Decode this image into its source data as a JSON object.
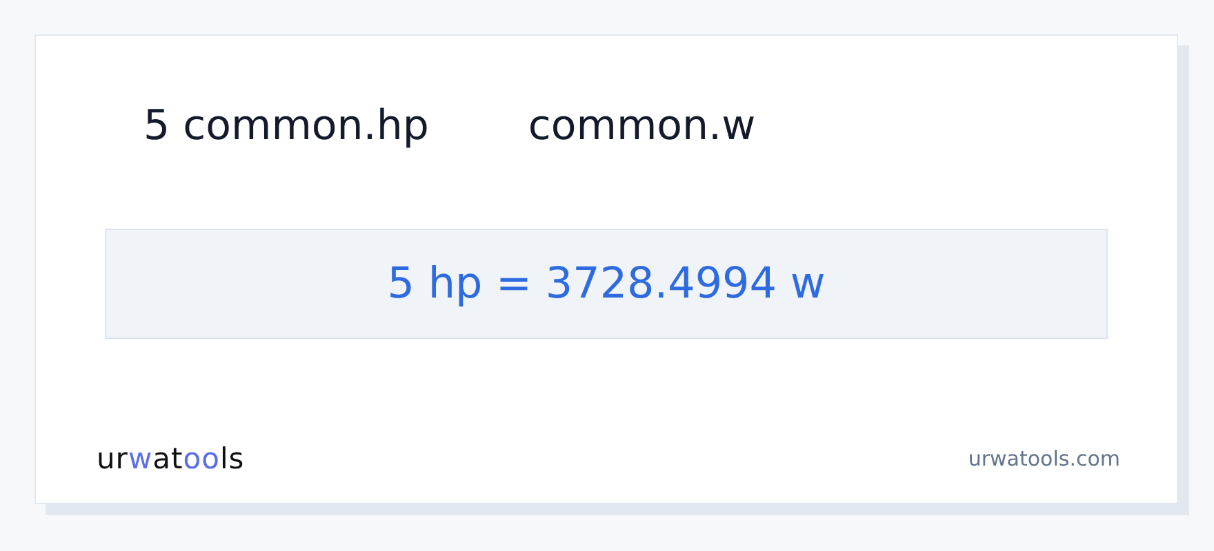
{
  "header": {
    "from": "5 common.hp",
    "to": "common.w"
  },
  "result": "5 hp = 3728.4994 w",
  "footer": {
    "logo": [
      {
        "text": "ur",
        "accent": false
      },
      {
        "text": "w",
        "accent": true
      },
      {
        "text": "at",
        "accent": false
      },
      {
        "text": "oo",
        "accent": true
      },
      {
        "text": "ls",
        "accent": false
      }
    ],
    "site": "urwatools.com"
  }
}
